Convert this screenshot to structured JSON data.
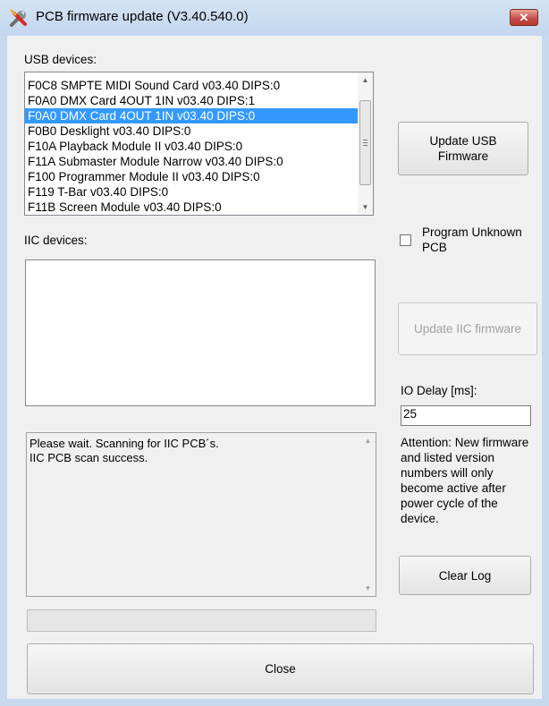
{
  "window": {
    "title": "PCB firmware update (V3.40.540.0)",
    "close_glyph": "✕",
    "icon": "wrench-screwdriver-icon"
  },
  "usb": {
    "label": "USB devices:",
    "items": [
      "F0C8  SMPTE MIDI Sound Card  v03.40  DIPS:0",
      "F0A0  DMX Card 4OUT 1IN  v03.40  DIPS:1",
      "F0A0  DMX Card 4OUT 1IN  v03.40  DIPS:0",
      "F0B0  Desklight  v03.40  DIPS:0",
      "F10A  Playback Module II  v03.40  DIPS:0",
      "F11A  Submaster Module Narrow  v03.40  DIPS:0",
      "F100  Programmer Module II  v03.40  DIPS:0",
      "F119  T-Bar  v03.40  DIPS:0",
      "F11B  Screen Module  v03.40  DIPS:0"
    ],
    "selected_index": 2,
    "update_button": "Update USB Firmware"
  },
  "iic": {
    "label": "IIC devices:",
    "items": [],
    "update_button": "Update IIC firmware"
  },
  "options": {
    "program_unknown_label": "Program Unknown PCB",
    "program_unknown_checked": false,
    "io_delay_label": "IO Delay [ms]:",
    "io_delay_value": "25"
  },
  "log": {
    "lines": [
      "Please wait. Scanning for IIC PCB´s.",
      "IIC PCB scan success."
    ]
  },
  "attention": {
    "text": "Attention: New firmware and listed version numbers will only become active after power cycle of the device."
  },
  "buttons": {
    "clear_log": "Clear Log",
    "close": "Close"
  },
  "progress": {
    "value": 0
  },
  "colors": {
    "selection": "#3399ff",
    "title_bar": "#c6d9ef",
    "close_button": "#c75050"
  }
}
